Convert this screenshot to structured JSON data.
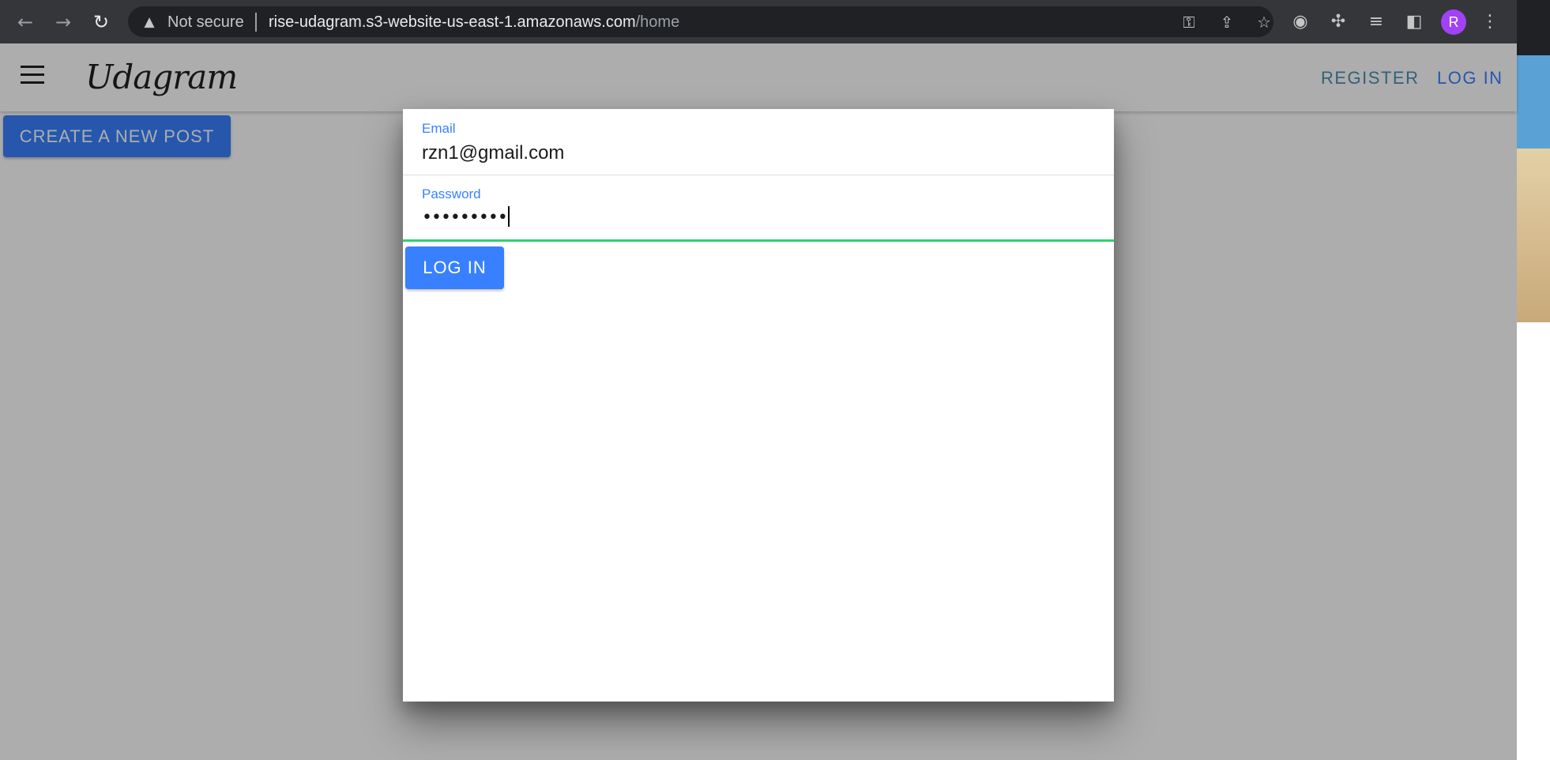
{
  "browser": {
    "back_icon": "arrow-left-icon",
    "forward_icon": "arrow-right-icon",
    "reload_icon": "reload-icon",
    "security_label": "Not secure",
    "url_host": "rise-udagram.s3-website-us-east-1.amazonaws.com",
    "url_path": "/home",
    "profile_initial": "R",
    "profile_color": "#a142f4"
  },
  "app": {
    "brand": "Udagram",
    "nav": {
      "register": "REGISTER",
      "login": "LOG IN"
    },
    "create_post": "CREATE A NEW POST",
    "accent_color": "#3880ff"
  },
  "login_modal": {
    "email": {
      "label": "Email",
      "value": "rzn1@gmail.com"
    },
    "password": {
      "label": "Password",
      "masked_value": "•••••••••"
    },
    "submit": "LOG IN",
    "valid_color": "#2dd36f"
  }
}
